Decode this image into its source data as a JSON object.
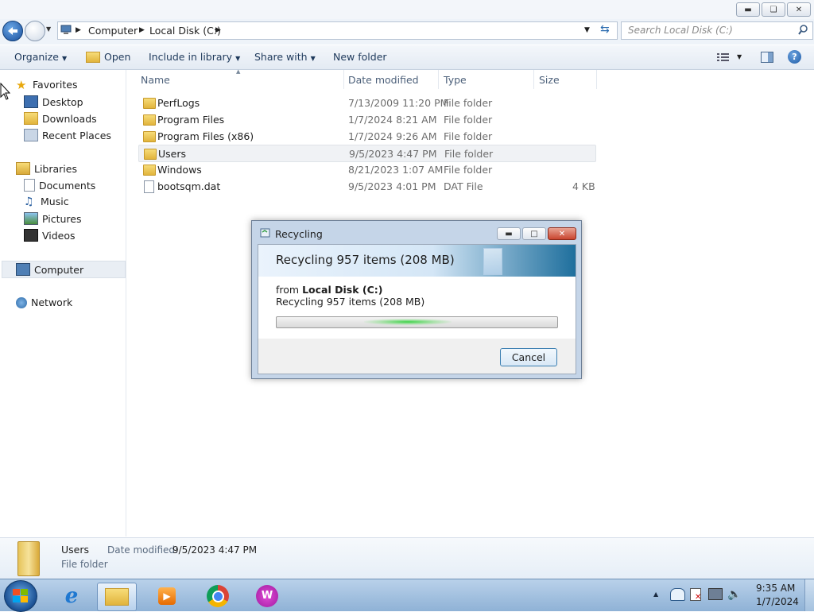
{
  "window": {
    "minimize_icon": "minimize-icon",
    "maximize_icon": "restore-icon",
    "close_icon": "close-icon"
  },
  "address": {
    "crumbs": [
      "Computer",
      "Local Disk (C:)"
    ],
    "search_placeholder": "Search Local Disk (C:)"
  },
  "toolbar": {
    "organize": "Organize",
    "open": "Open",
    "include_in_library": "Include in library",
    "share_with": "Share with",
    "new_folder": "New folder"
  },
  "nav": {
    "favorites": "Favorites",
    "desktop": "Desktop",
    "downloads": "Downloads",
    "recent_places": "Recent Places",
    "libraries": "Libraries",
    "documents": "Documents",
    "music": "Music",
    "pictures": "Pictures",
    "videos": "Videos",
    "computer": "Computer",
    "network": "Network"
  },
  "columns": {
    "name": "Name",
    "date_modified": "Date modified",
    "type": "Type",
    "size": "Size"
  },
  "files": [
    {
      "name": "PerfLogs",
      "date": "7/13/2009 11:20 PM",
      "type": "File folder",
      "size": ""
    },
    {
      "name": "Program Files",
      "date": "1/7/2024 8:21 AM",
      "type": "File folder",
      "size": ""
    },
    {
      "name": "Program Files (x86)",
      "date": "1/7/2024 9:26 AM",
      "type": "File folder",
      "size": ""
    },
    {
      "name": "Users",
      "date": "9/5/2023 4:47 PM",
      "type": "File folder",
      "size": ""
    },
    {
      "name": "Windows",
      "date": "8/21/2023 1:07 AM",
      "type": "File folder",
      "size": ""
    },
    {
      "name": "bootsqm.dat",
      "date": "9/5/2023 4:01 PM",
      "type": "DAT File",
      "size": "4 KB"
    }
  ],
  "dialog": {
    "title": "Recycling",
    "heading": "Recycling 957 items (208 MB)",
    "from_label": "from",
    "from_value": "Local Disk (C:)",
    "status": "Recycling 957 items (208 MB)",
    "cancel": "Cancel"
  },
  "details": {
    "name": "Users",
    "date_label": "Date modified:",
    "date_value": "9/5/2023 4:47 PM",
    "type": "File folder"
  },
  "taskbar": {
    "time": "9:35 AM",
    "date": "1/7/2024"
  }
}
